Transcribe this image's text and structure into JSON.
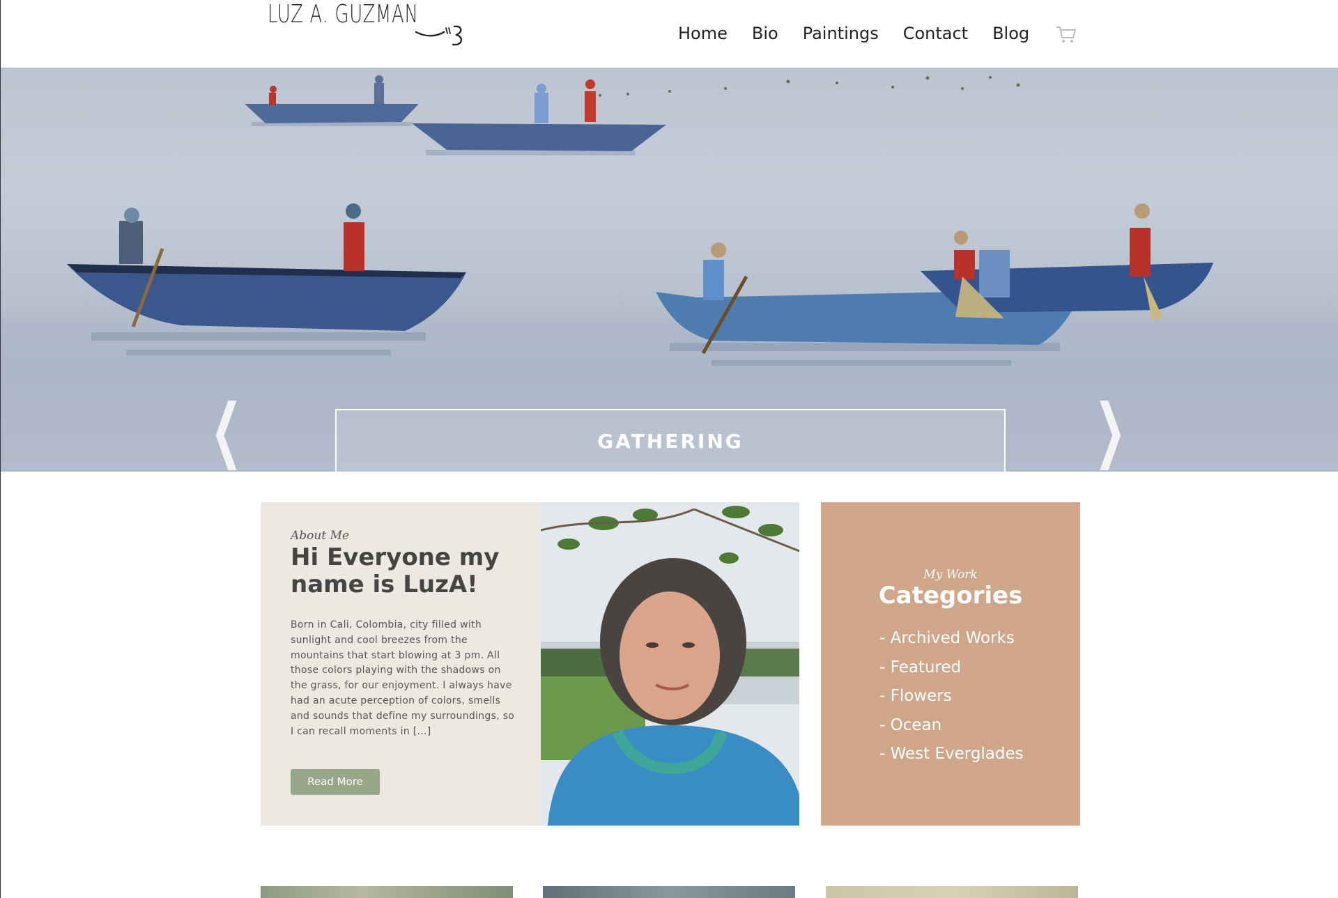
{
  "header": {
    "logo_text": "LUZ A. GUZMAN",
    "nav": [
      "Home",
      "Bio",
      "Paintings",
      "Contact",
      "Blog"
    ],
    "cart_icon": "shopping-cart-icon"
  },
  "hero": {
    "caption": "GATHERING",
    "prev_icon": "chevron-left-icon",
    "next_icon": "chevron-right-icon"
  },
  "about": {
    "kicker": "About Me",
    "title": "Hi Everyone my name is LuzA!",
    "body": "Born in Cali, Colombia, city filled with sunlight and cool breezes from the mountains that start blowing at 3 pm. All those colors playing with the shadows on the grass, for our enjoyment. I always have had an acute perception of colors, smells and sounds that define my surroundings, so I can recall moments in […]",
    "button": "Read More"
  },
  "categories": {
    "kicker": "My Work",
    "title": "Categories",
    "items": [
      "- Archived Works",
      "- Featured",
      "- Flowers",
      "- Ocean",
      "- West Everglades"
    ]
  },
  "colors": {
    "about_bg": "#ede8e2",
    "categories_bg": "#cfa68a",
    "button_bg": "#97a88a"
  }
}
